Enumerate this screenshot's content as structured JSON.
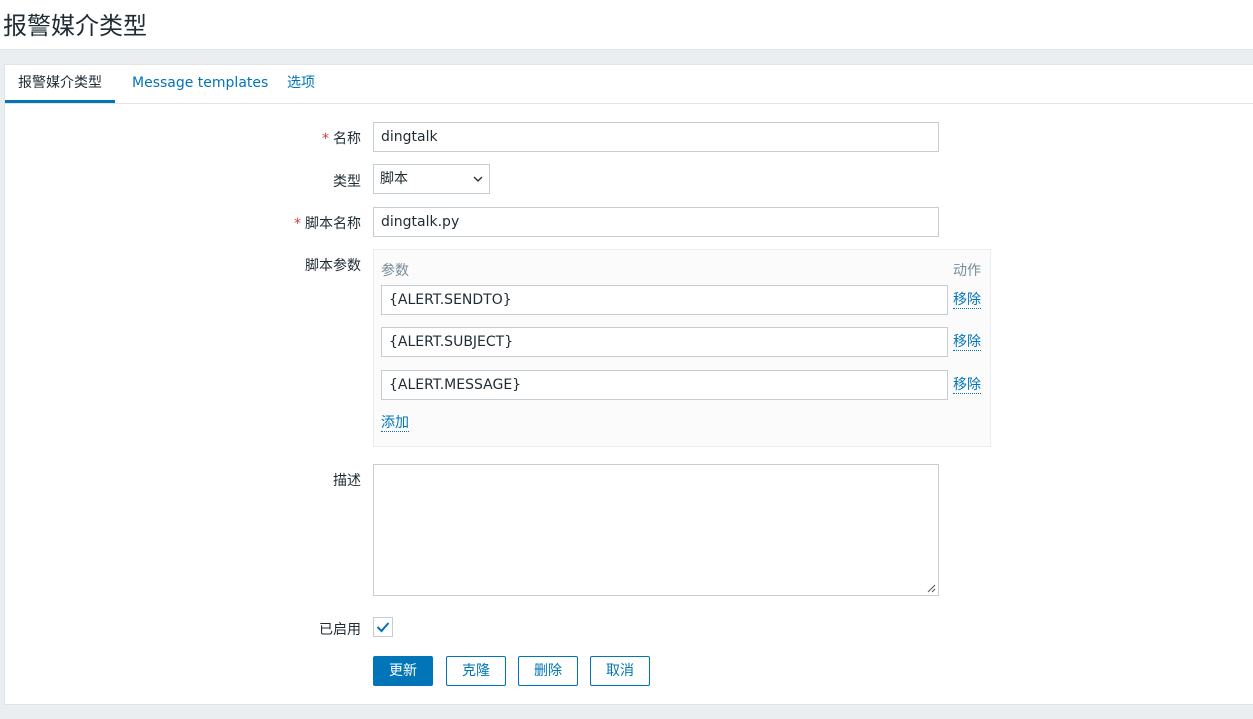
{
  "header": {
    "title": "报警媒介类型"
  },
  "tabs": [
    {
      "label": "报警媒介类型"
    },
    {
      "label": "Message templates"
    },
    {
      "label": "选项"
    }
  ],
  "form": {
    "name": {
      "label": "名称",
      "value": "dingtalk",
      "required": true
    },
    "type": {
      "label": "类型",
      "value": "脚本"
    },
    "script_name": {
      "label": "脚本名称",
      "value": "dingtalk.py",
      "required": true
    },
    "script_params": {
      "label": "脚本参数",
      "col_param": "参数",
      "col_action": "动作",
      "rows": [
        {
          "value": "{ALERT.SENDTO}",
          "action": "移除"
        },
        {
          "value": "{ALERT.SUBJECT}",
          "action": "移除"
        },
        {
          "value": "{ALERT.MESSAGE}",
          "action": "移除"
        }
      ],
      "add_label": "添加"
    },
    "description": {
      "label": "描述",
      "value": ""
    },
    "enabled": {
      "label": "已启用",
      "checked": true
    }
  },
  "buttons": {
    "update": "更新",
    "clone": "克隆",
    "delete": "删除",
    "cancel": "取消"
  },
  "colors": {
    "accent": "#0275b8",
    "required": "#e33734",
    "background": "#ebeef0"
  }
}
